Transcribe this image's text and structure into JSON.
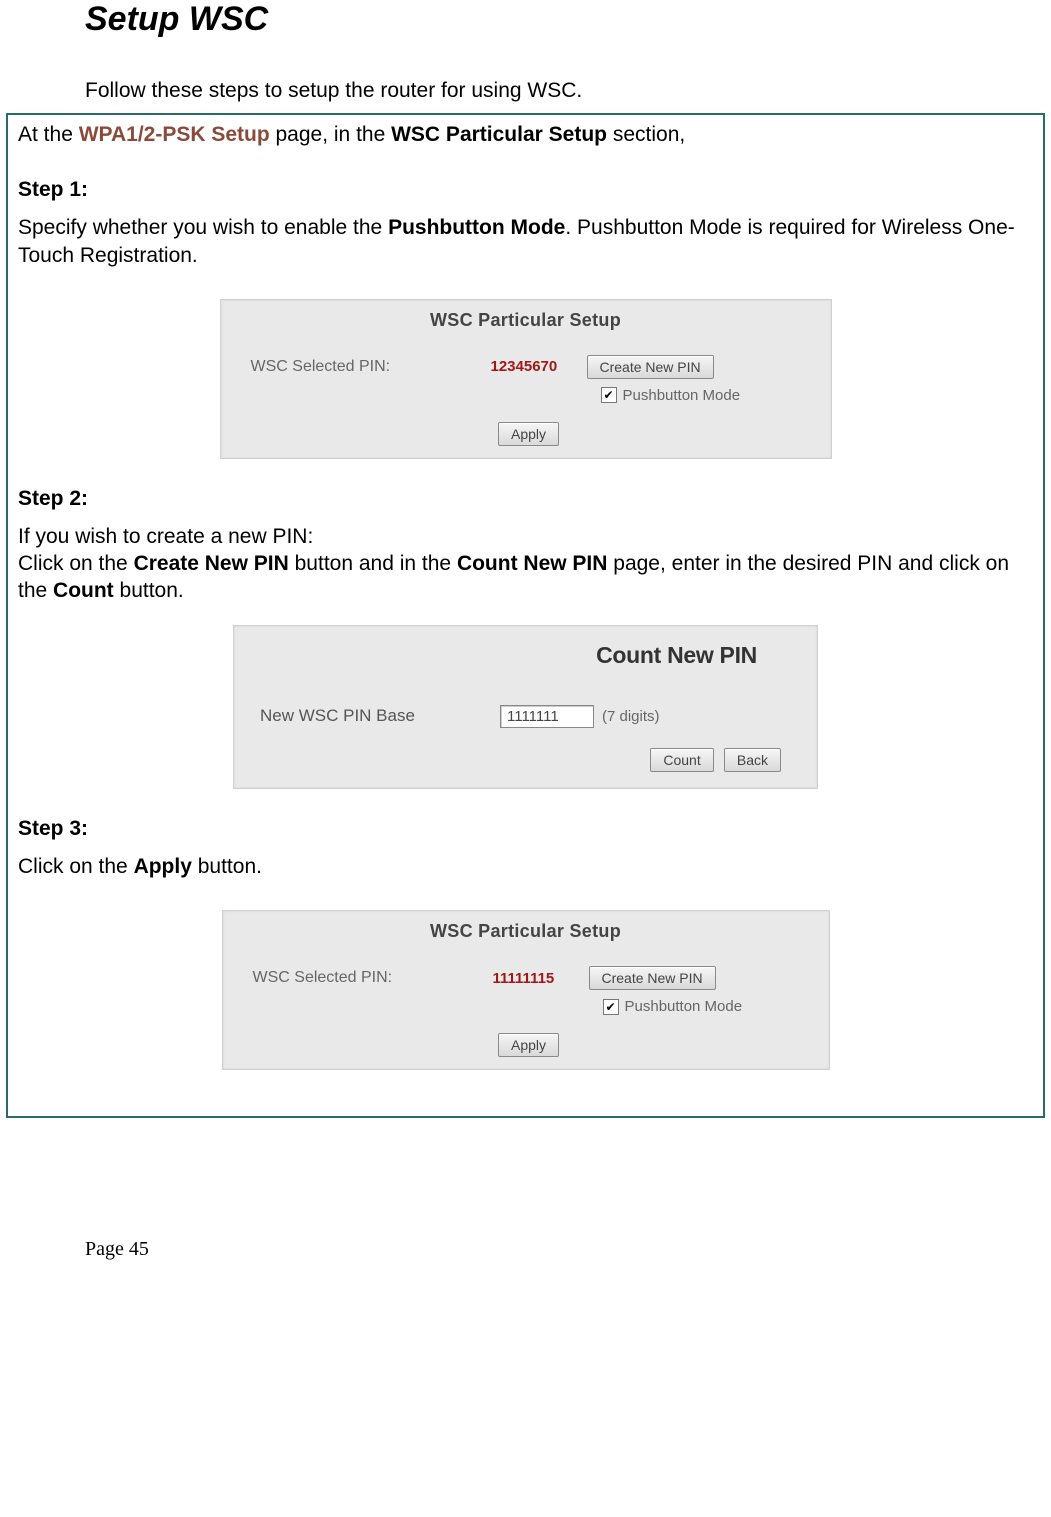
{
  "title": "Setup WSC",
  "intro": "Follow these steps to setup the router for using WSC.",
  "box_intro": {
    "prefix": "At the ",
    "link": "WPA1/2-PSK Setup",
    "mid": " page, in the ",
    "bold": "WSC Particular Setup",
    "suffix": " section,"
  },
  "step1": {
    "label": "Step 1:",
    "text_prefix": "Specify whether you wish to enable the ",
    "text_bold": "Pushbutton Mode",
    "text_suffix": ". Pushbutton Mode is required for Wireless One-Touch Registration."
  },
  "panel1": {
    "title": "WSC Particular Setup",
    "pin_label": "WSC Selected PIN:",
    "pin_value": "12345670",
    "create_btn": "Create New PIN",
    "pushbutton_label": "Pushbutton Mode",
    "apply_btn": "Apply"
  },
  "step2": {
    "label": "Step 2:",
    "line1": "If you wish to create a new PIN:",
    "line2_prefix": "Click on the ",
    "line2_b1": "Create New PIN",
    "line2_mid1": " button and in the ",
    "line2_b2": "Count New PIN",
    "line2_mid2": " page, enter in the desired PIN and click on the ",
    "line2_b3": "Count",
    "line2_suffix": " button."
  },
  "panel2": {
    "title": "Count New PIN",
    "label": "New WSC PIN Base",
    "input_value": "1111111",
    "suffix": "(7 digits)",
    "count_btn": "Count",
    "back_btn": "Back"
  },
  "step3": {
    "label": "Step 3:",
    "text_prefix": "Click on the ",
    "text_bold": "Apply",
    "text_suffix": " button."
  },
  "panel3": {
    "title": "WSC Particular Setup",
    "pin_label": "WSC Selected PIN:",
    "pin_value": "11111115",
    "create_btn": "Create New PIN",
    "pushbutton_label": "Pushbutton Mode",
    "apply_btn": "Apply"
  },
  "footer": "Page 45"
}
